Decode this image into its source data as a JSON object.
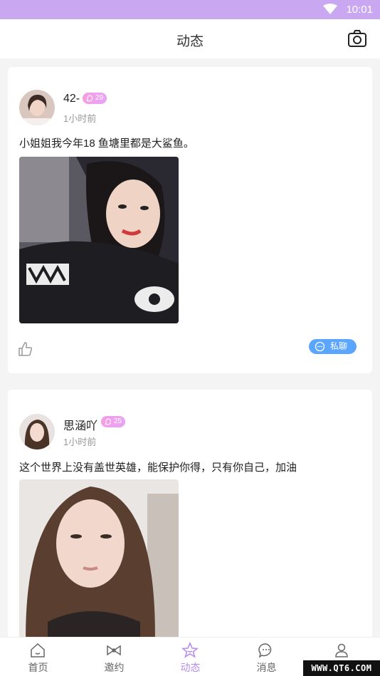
{
  "status_bar": {
    "time": "10:01"
  },
  "nav": {
    "title": "动态",
    "camera_icon": "camera-icon"
  },
  "colors": {
    "accent": "#c9a8f1",
    "tab_active": "#b68cf0",
    "chat_button": "#5aa6ff",
    "level_badge": "#f59ee2"
  },
  "posts": [
    {
      "name": "42-",
      "level": "29",
      "time": "1小时前",
      "content": "小姐姐我今年18 鱼塘里都是大鲨鱼。",
      "chat_label": "私聊"
    },
    {
      "name": "思涵吖",
      "level": "25",
      "time": "1小时前",
      "content": "这个世界上没有盖世英雄，能保护你得，只有你自己，加油"
    }
  ],
  "tabs": [
    {
      "label": "首页",
      "icon": "home-icon"
    },
    {
      "label": "邀约",
      "icon": "bow-icon"
    },
    {
      "label": "动态",
      "icon": "star-icon",
      "active": true
    },
    {
      "label": "消息",
      "icon": "message-icon"
    },
    {
      "label": "我的",
      "icon": "user-icon"
    }
  ],
  "watermark": "WWW.QT6.COM"
}
